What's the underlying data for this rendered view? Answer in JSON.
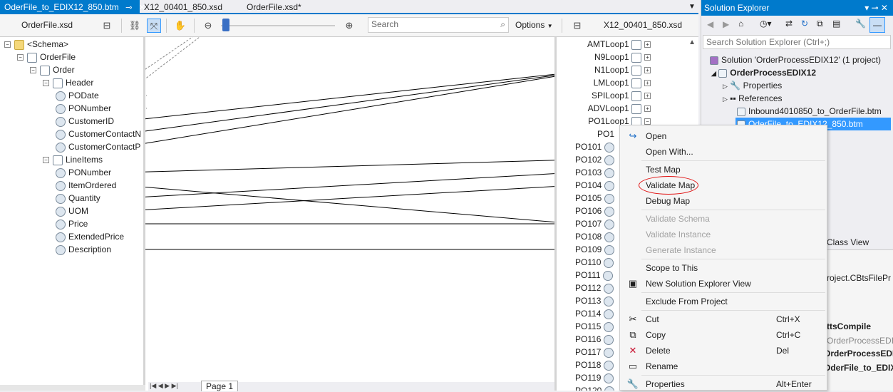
{
  "tabs": [
    {
      "label": "OderFile_to_EDIX12_850.btm",
      "active": true
    },
    {
      "label": "X12_00401_850.xsd",
      "active": false
    },
    {
      "label": "OrderFile.xsd*",
      "active": false
    }
  ],
  "toolbar": {
    "left_schema": "OrderFile.xsd",
    "right_schema": "X12_00401_850.xsd",
    "search_placeholder": "Search",
    "options_label": "Options"
  },
  "source_tree": [
    {
      "label": "<Schema>",
      "indent": 0,
      "type": "folder",
      "exp": "−"
    },
    {
      "label": "OrderFile",
      "indent": 1,
      "type": "rec",
      "exp": "−"
    },
    {
      "label": "Order",
      "indent": 2,
      "type": "rec",
      "exp": "−"
    },
    {
      "label": "Header",
      "indent": 3,
      "type": "rec",
      "exp": "−"
    },
    {
      "label": "PODate",
      "indent": 4,
      "type": "fld"
    },
    {
      "label": "PONumber",
      "indent": 4,
      "type": "fld"
    },
    {
      "label": "CustomerID",
      "indent": 4,
      "type": "fld"
    },
    {
      "label": "CustomerContactN",
      "indent": 4,
      "type": "fld"
    },
    {
      "label": "CustomerContactP",
      "indent": 4,
      "type": "fld"
    },
    {
      "label": "LineItems",
      "indent": 3,
      "type": "rec",
      "exp": "−"
    },
    {
      "label": "PONumber",
      "indent": 4,
      "type": "fld"
    },
    {
      "label": "ItemOrdered",
      "indent": 4,
      "type": "fld"
    },
    {
      "label": "Quantity",
      "indent": 4,
      "type": "fld"
    },
    {
      "label": "UOM",
      "indent": 4,
      "type": "fld"
    },
    {
      "label": "Price",
      "indent": 4,
      "type": "fld"
    },
    {
      "label": "ExtendedPrice",
      "indent": 4,
      "type": "fld"
    },
    {
      "label": "Description",
      "indent": 4,
      "type": "fld"
    }
  ],
  "dest_tree": [
    "AMTLoop1",
    "N9Loop1",
    "N1Loop1",
    "LMLoop1",
    "SPILoop1",
    "ADVLoop1",
    "PO1Loop1",
    "PO1",
    "PO101",
    "PO102",
    "PO103",
    "PO104",
    "PO105",
    "PO106",
    "PO107",
    "PO108",
    "PO109",
    "PO110",
    "PO111",
    "PO112",
    "PO113",
    "PO114",
    "PO115",
    "PO116",
    "PO117",
    "PO118",
    "PO119",
    "PO120"
  ],
  "page_tab": "Page 1",
  "solution_explorer": {
    "title": "Solution Explorer",
    "search_placeholder": "Search Solution Explorer (Ctrl+;)",
    "items": [
      {
        "label": "Solution 'OrderProcessEDIX12' (1 project)"
      },
      {
        "label": "OrderProcessEDIX12"
      },
      {
        "label": "Properties"
      },
      {
        "label": "References"
      },
      {
        "label": "Inbound4010850_to_OrderFile.btm"
      },
      {
        "label": "OderFile_to_EDIX12_850.btm"
      }
    ],
    "class_view": "Class View",
    "props_fragments": [
      "roject.CBtsFilePr",
      "ttsCompile",
      "OrderProcessEDIX",
      "OrderProcessEDI",
      "OderFile_to_EDIX"
    ]
  },
  "context_menu": [
    {
      "label": "Open",
      "icon": "↪",
      "enabled": true
    },
    {
      "label": "Open With...",
      "enabled": true
    },
    {
      "sep": true
    },
    {
      "label": "Test Map",
      "enabled": true
    },
    {
      "label": "Validate Map",
      "enabled": true
    },
    {
      "label": "Debug Map",
      "enabled": true
    },
    {
      "sep": true
    },
    {
      "label": "Validate Schema",
      "enabled": false
    },
    {
      "label": "Validate Instance",
      "enabled": false
    },
    {
      "label": "Generate Instance",
      "enabled": false
    },
    {
      "sep": true
    },
    {
      "label": "Scope to This",
      "enabled": true
    },
    {
      "label": "New Solution Explorer View",
      "icon": "▣",
      "enabled": true
    },
    {
      "sep": true
    },
    {
      "label": "Exclude From Project",
      "enabled": true
    },
    {
      "sep": true
    },
    {
      "label": "Cut",
      "icon": "✂",
      "shortcut": "Ctrl+X",
      "enabled": true
    },
    {
      "label": "Copy",
      "icon": "⧉",
      "shortcut": "Ctrl+C",
      "enabled": true
    },
    {
      "label": "Delete",
      "icon": "✕",
      "shortcut": "Del",
      "enabled": true
    },
    {
      "label": "Rename",
      "icon": "▭",
      "enabled": true
    },
    {
      "sep": true
    },
    {
      "label": "Properties",
      "icon": "🔧",
      "shortcut": "Alt+Enter",
      "enabled": true
    }
  ],
  "colors": {
    "accent": "#007acc",
    "selection": "#3399ff",
    "annotation": "#e01010"
  }
}
